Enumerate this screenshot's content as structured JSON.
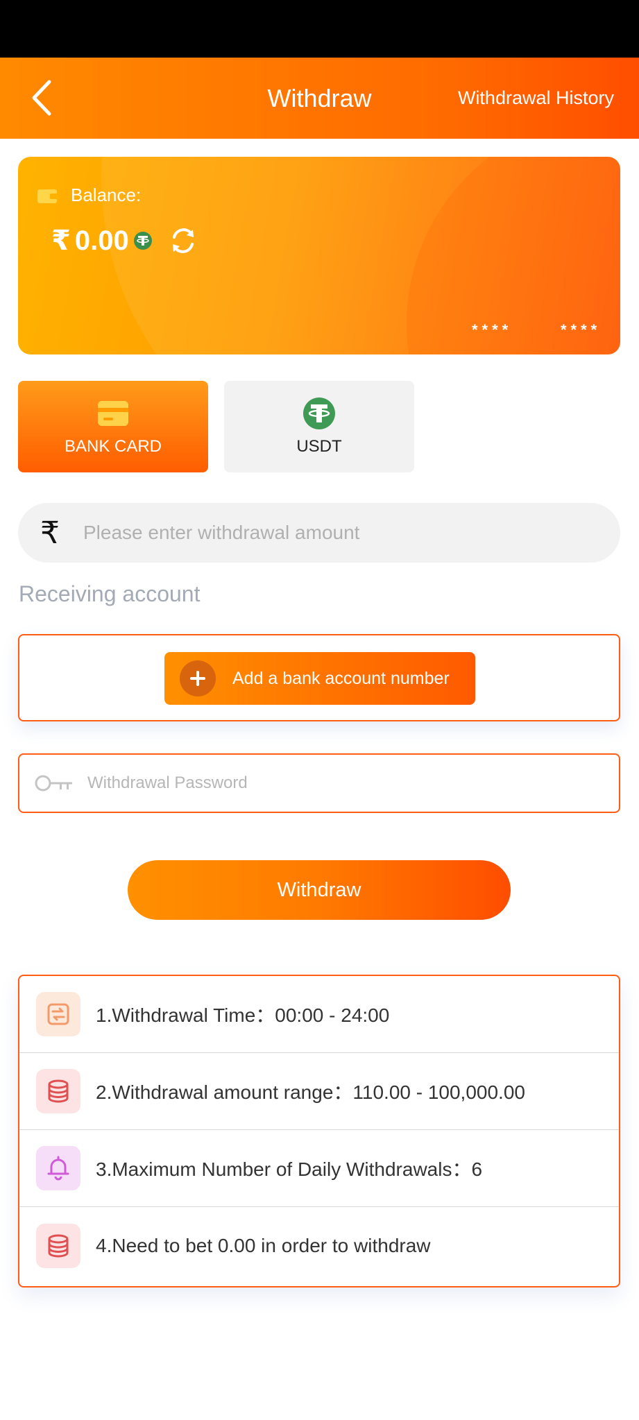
{
  "header": {
    "title": "Withdraw",
    "history_label": "Withdrawal History"
  },
  "balance": {
    "label": "Balance:",
    "currency_symbol": "₹",
    "amount": "0.00",
    "card_mask_1": "****",
    "card_mask_2": "****"
  },
  "methods": [
    {
      "label": "BANK CARD",
      "active": true,
      "icon": "bank-card-icon"
    },
    {
      "label": "USDT",
      "active": false,
      "icon": "usdt-icon"
    }
  ],
  "amount_input": {
    "currency_symbol": "₹",
    "placeholder": "Please enter withdrawal amount",
    "value": ""
  },
  "receiving": {
    "label": "Receiving account",
    "add_bank_label": "Add a bank account number"
  },
  "password": {
    "placeholder": "Withdrawal Password",
    "value": ""
  },
  "withdraw_button_label": "Withdraw",
  "rules": [
    {
      "text": "1.Withdrawal Time：00:00 - 24:00",
      "icon": "clock-exchange-icon"
    },
    {
      "text": "2.Withdrawal amount range：110.00 - 100,000.00",
      "icon": "coin-stack-icon"
    },
    {
      "text": "3.Maximum Number of Daily Withdrawals：6",
      "icon": "bell-icon"
    },
    {
      "text": "4.Need to bet 0.00 in order to withdraw",
      "icon": "coin-stack-icon"
    }
  ],
  "colors": {
    "primary": "#ff6a00",
    "accent_dark": "#ff4e00",
    "usdt_green": "#50af95",
    "muted_label": "#a4aab5"
  }
}
